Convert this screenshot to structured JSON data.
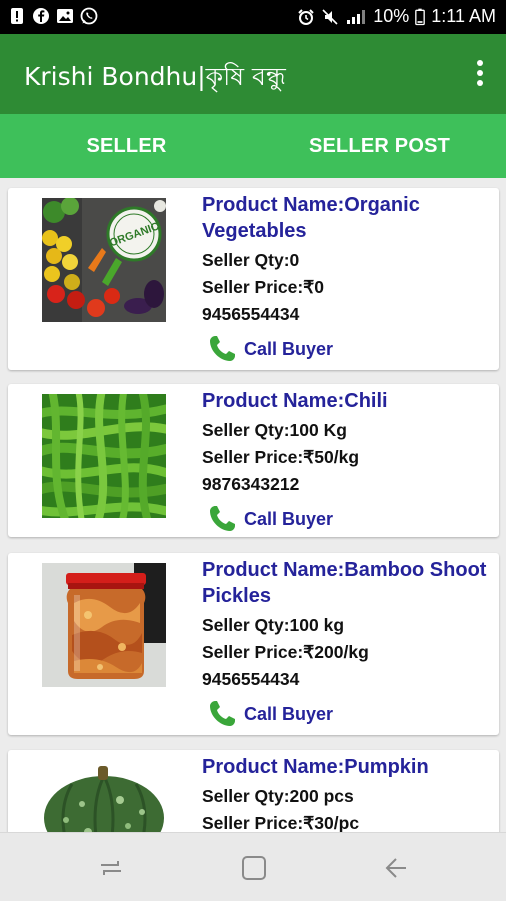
{
  "status_bar": {
    "battery_percent": "10%",
    "time": "1:11 AM",
    "left_icons": [
      "alert-icon",
      "facebook-icon",
      "gallery-icon",
      "whatsapp-icon"
    ],
    "right_icons": [
      "alarm-icon",
      "mute-icon",
      "signal-icon",
      "battery-icon"
    ]
  },
  "app_bar": {
    "title": "Krishi Bondhu|কৃষি বন্ধু",
    "color": "#2e8b34"
  },
  "tabs": [
    {
      "label": "SELLER"
    },
    {
      "label": "SELLER POST"
    }
  ],
  "tab_color": "#3ec05a",
  "products": [
    {
      "name": "Product Name:Organic Vegetables",
      "qty": "Seller Qty:0",
      "price": "Seller Price:₹0",
      "phone": "9456554434",
      "call_label": "Call Buyer",
      "image": "organic-vegetables",
      "image_text": "ORGANIC"
    },
    {
      "name": "Product Name:Chili",
      "qty": "Seller Qty:100 Kg",
      "price": "Seller Price:₹50/kg",
      "phone": "9876343212",
      "call_label": "Call Buyer",
      "image": "green-chili"
    },
    {
      "name": "Product Name:Bamboo Shoot Pickles",
      "qty": "Seller Qty:100 kg",
      "price": "Seller Price:₹200/kg",
      "phone": "9456554434",
      "call_label": "Call Buyer",
      "image": "pickle-jar"
    },
    {
      "name": "Product Name:Pumpkin",
      "qty": "Seller Qty:200 pcs",
      "price": "Seller Price:₹30/pc",
      "image": "pumpkin"
    }
  ],
  "colors": {
    "product_name": "#25239a",
    "call_icon": "#3aa63a"
  },
  "nav_bar": {
    "buttons": [
      "recent-apps-icon",
      "home-icon",
      "back-icon"
    ]
  }
}
